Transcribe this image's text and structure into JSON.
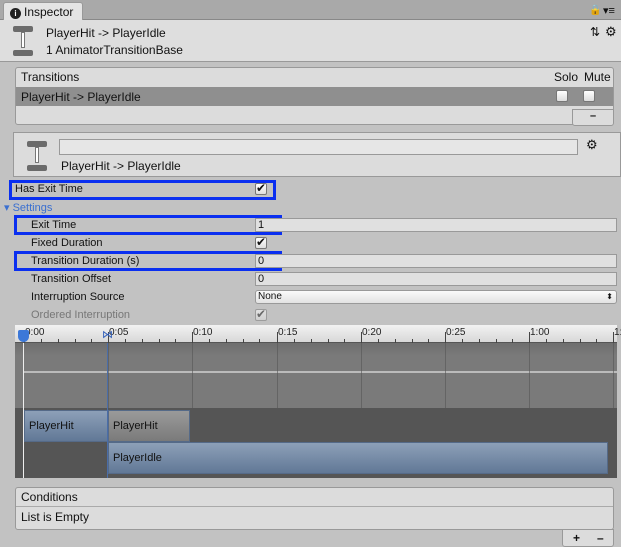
{
  "tab": {
    "label": "Inspector",
    "icon": "info-icon"
  },
  "header": {
    "title": "PlayerHit -> PlayerIdle",
    "subtitle": "1 AnimatorTransitionBase"
  },
  "transitions": {
    "header": "Transitions",
    "solo": "Solo",
    "mute": "Mute",
    "rows": [
      {
        "label": "PlayerHit -> PlayerIdle",
        "solo": false,
        "mute": false
      }
    ],
    "remove": "–"
  },
  "transition": {
    "name_value": "",
    "label": "PlayerHit -> PlayerIdle"
  },
  "has_exit_time": {
    "label": "Has Exit Time",
    "checked": true
  },
  "settings": {
    "label": "Settings",
    "exit_time": {
      "label": "Exit Time",
      "value": "1"
    },
    "fixed_duration": {
      "label": "Fixed Duration",
      "checked": true
    },
    "transition_duration": {
      "label": "Transition Duration (s)",
      "value": "0"
    },
    "transition_offset": {
      "label": "Transition Offset",
      "value": "0"
    },
    "interruption_source": {
      "label": "Interruption Source",
      "value": "None"
    },
    "ordered_interruption": {
      "label": "Ordered Interruption",
      "checked": true
    }
  },
  "timeline": {
    "ticks": [
      "0:00",
      "0:05",
      "0:10",
      "0:15",
      "0:20",
      "0:25",
      "1:00",
      "1:"
    ],
    "clips": {
      "source": "PlayerHit",
      "source_tail": "PlayerHit",
      "dest": "PlayerIdle"
    }
  },
  "conditions": {
    "header": "Conditions",
    "empty": "List is Empty",
    "add": "+",
    "remove": "–"
  },
  "colors": {
    "highlight": "#0a2ff0",
    "settings_link": "#3a6fd0",
    "selected_row": "#8f8f8f"
  }
}
